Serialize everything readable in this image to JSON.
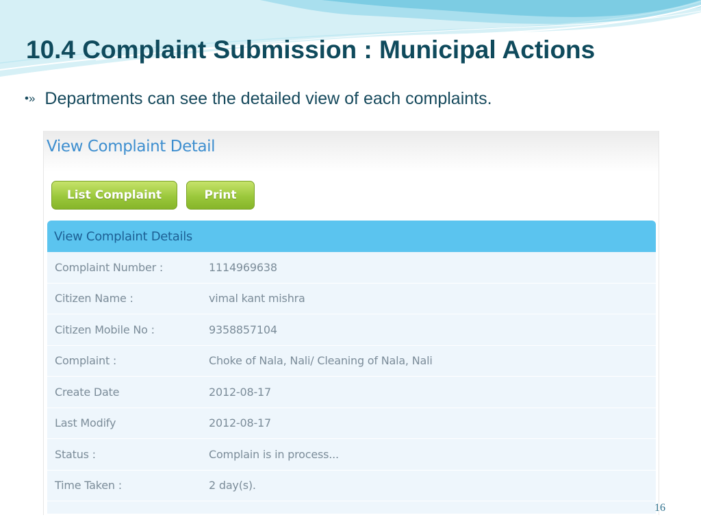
{
  "slide": {
    "title": "10.4 Complaint Submission : Municipal Actions",
    "bullet_marker": "•»",
    "bullet_text": "Departments can see the detailed view of each complaints.",
    "page_number": "16"
  },
  "screenshot": {
    "page_title": "View Complaint Detail",
    "buttons": {
      "list_complaint": "List Complaint",
      "print": "Print"
    },
    "panel": {
      "title": "View Complaint Details",
      "rows": [
        {
          "label": "Complaint Number :",
          "value": "1114969638"
        },
        {
          "label": "Citizen Name :",
          "value": "vimal kant mishra"
        },
        {
          "label": "Citizen Mobile No :",
          "value": "9358857104"
        },
        {
          "label": "Complaint :",
          "value": "Choke of Nala, Nali/ Cleaning of Nala, Nali"
        },
        {
          "label": "Create Date",
          "value": "2012-08-17"
        },
        {
          "label": "Last Modify",
          "value": "2012-08-17"
        },
        {
          "label": "Status :",
          "value": "Complain is in process..."
        },
        {
          "label": "Time Taken :",
          "value": "2 day(s)."
        }
      ]
    }
  },
  "colors": {
    "title": "#0f4a5c",
    "wave_light": "#cfeef5",
    "wave_mid": "#8fd3e8",
    "button_green": "#9bc83c",
    "panel_header": "#5bc4ef",
    "panel_bg": "#eef6fc"
  }
}
